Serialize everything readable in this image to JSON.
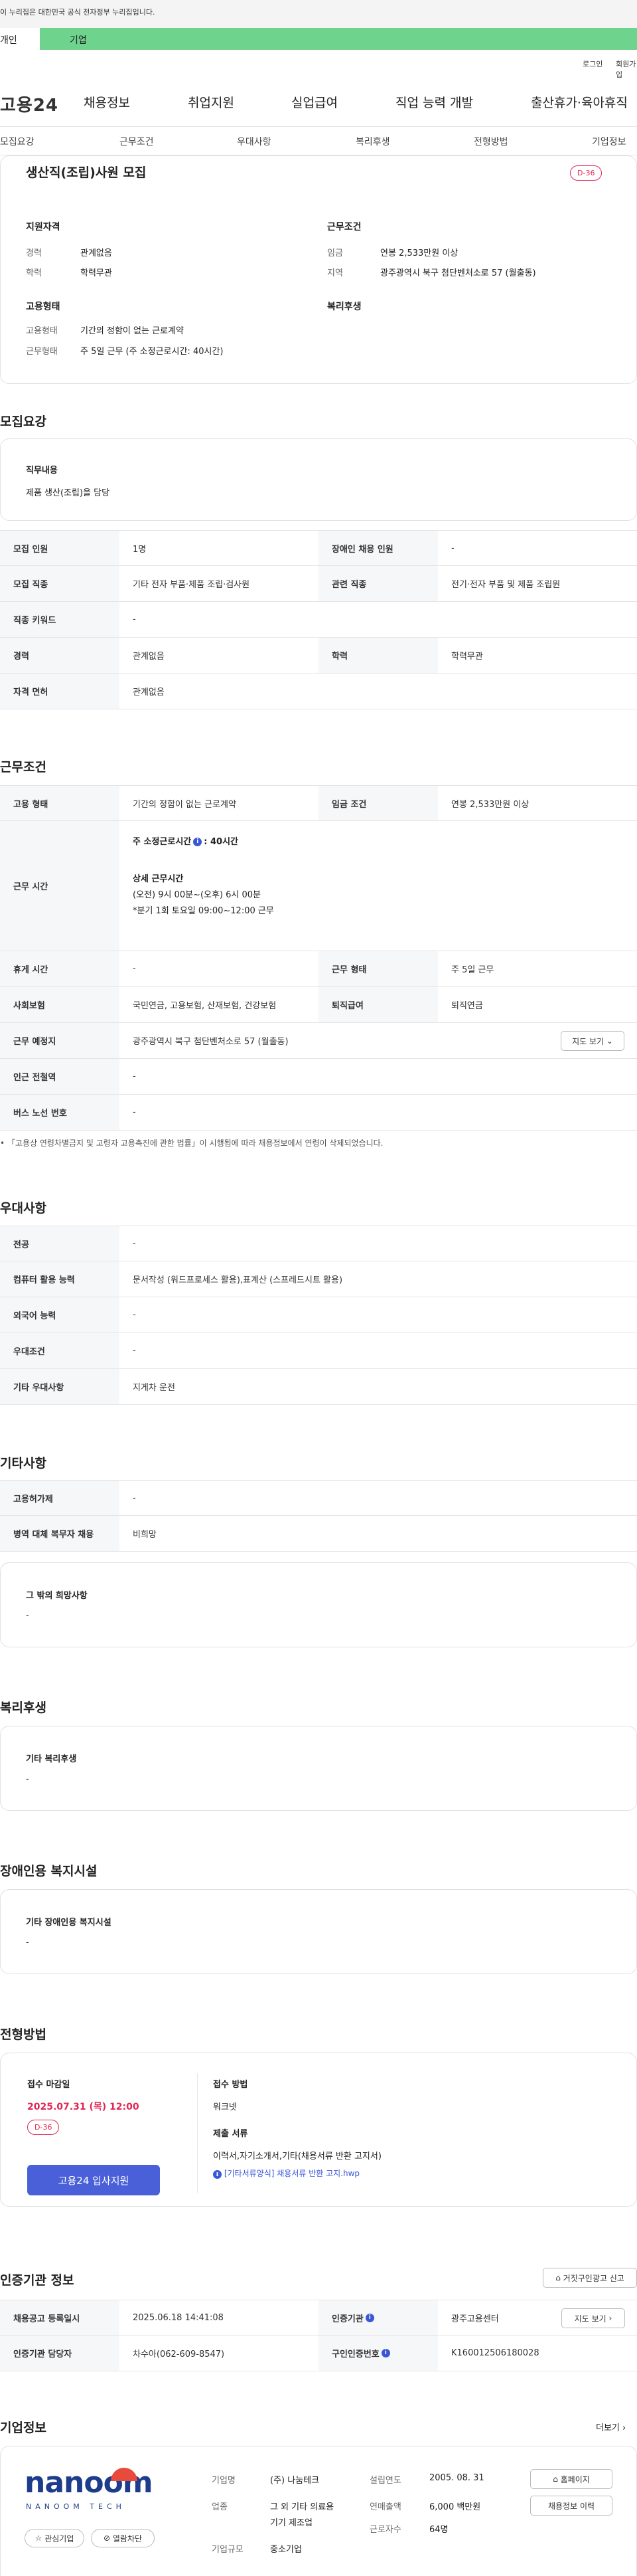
{
  "gov_banner": "이 누리집은 대한민국 공식 전자정부 누리집입니다.",
  "site_tabs": [
    "개인",
    "기업"
  ],
  "utils": [
    "로그인",
    "회원가입"
  ],
  "logo": "고용24",
  "gnb": [
    "채용정보",
    "취업지원",
    "실업급여",
    "직업 능력 개발",
    "출산휴가·육아휴직"
  ],
  "anchors": [
    "모집요강",
    "근무조건",
    "우대사항",
    "복리후생",
    "전형방법",
    "기업정보"
  ],
  "job": {
    "title": "생산직(조립)사원 모집",
    "dday": "D-36"
  },
  "summary": {
    "qual_title": "지원자격",
    "career_lbl": "경력",
    "career": "관계없음",
    "edu_lbl": "학력",
    "edu": "학력무관",
    "cond_title": "근무조건",
    "wage_lbl": "임금",
    "wage": "연봉 2,533만원 이상",
    "region_lbl": "지역",
    "region": "광주광역시 북구 첨단벤처소로 57 (월출동)",
    "emp_title": "고용형태",
    "emptype_lbl": "고용형태",
    "emptype": "기간의 정함이 없는 근로계약",
    "worktype_lbl": "근무형태",
    "worktype": "주 5일 근무 (주 소정근로시간: 40시간)",
    "welfare_title": "복리후생"
  },
  "recruit": {
    "heading": "모집요강",
    "duty_title": "직무내용",
    "duty": "제품 생산(조립)을 담당",
    "rows": [
      {
        "k1": "모집 인원",
        "v1": "1명",
        "k2": "장애인 채용 인원",
        "v2": "-"
      },
      {
        "k1": "모집 직종",
        "v1": "기타 전자 부품·제품 조립·검사원",
        "k2": "관련 직종",
        "v2": "전기·전자 부품 및 제품 조립원"
      },
      {
        "k1": "직종 키워드",
        "v1": "-"
      },
      {
        "k1": "경력",
        "v1": "관계없음",
        "k2": "학력",
        "v2": "학력무관"
      },
      {
        "k1": "자격 면허",
        "v1": "관계없음"
      }
    ]
  },
  "conditions": {
    "heading": "근무조건",
    "emp_k": "고용 형태",
    "emp_v": "기간의 정함이 없는 근로계약",
    "wage_k": "임금 조건",
    "wage_v": "연봉 2,533만원 이상",
    "hours_k": "근무 시간",
    "hours_main": "주 소정근로시간",
    "hours_val": ": 40시간",
    "detail_title": "상세 근무시간",
    "detail1": "(오전) 9시 00분~(오후) 6시 00분",
    "detail2": "*분기 1회 토요일 09:00~12:00 근무",
    "rest_k": "휴게 시간",
    "rest_v": "-",
    "form_k": "근무 형태",
    "form_v": "주 5일 근무",
    "ins_k": "사회보험",
    "ins_v": "국민연금, 고용보험, 산재보험, 건강보험",
    "ret_k": "퇴직급여",
    "ret_v": "퇴직연금",
    "place_k": "근무 예정지",
    "place_v": "광주광역시 북구 첨단벤처소로 57 (월출동)",
    "map_btn": "지도 보기",
    "station_k": "인근 전철역",
    "station_v": "-",
    "bus_k": "버스 노선 번호",
    "bus_v": "-",
    "law_note": "「고용상 연령차별금지 및 고령자 고용촉진에 관한 법률」이 시행됨에 따라 채용정보에서 연령이 삭제되었습니다."
  },
  "prefer": {
    "heading": "우대사항",
    "rows": [
      {
        "k": "전공",
        "v": "-"
      },
      {
        "k": "컴퓨터 활용 능력",
        "v": "문서작성 (워드프로세스 활용),표계산 (스프레드시트 활용)"
      },
      {
        "k": "외국어 능력",
        "v": "-"
      },
      {
        "k": "우대조건",
        "v": "-"
      },
      {
        "k": "기타 우대사항",
        "v": "지게차 운전"
      }
    ]
  },
  "etc": {
    "heading": "기타사항",
    "rows": [
      {
        "k": "고용허가제",
        "v": "-"
      },
      {
        "k": "병역 대체 복무자 채용",
        "v": "비희망"
      }
    ],
    "other_title": "그 밖의 희망사항",
    "other_v": "-"
  },
  "welfare": {
    "heading": "복리후생",
    "title": "기타 복리후생",
    "v": "-"
  },
  "disability": {
    "heading": "장애인용 복지시설",
    "title": "기타 장애인용 복지시설",
    "v": "-"
  },
  "process": {
    "heading": "전형방법",
    "deadline_lbl": "접수 마감일",
    "deadline": "2025.07.31 (목) 12:00",
    "dday": "D-36",
    "apply_btn": "고용24 입사지원",
    "method_lbl": "접수 방법",
    "method": "워크넷",
    "docs_lbl": "제출 서류",
    "docs": "이력서,자기소개서,기타(채용서류 반환 고지서)",
    "file": "[기타서류양식] 채용서류 반환 고지.hwp"
  },
  "cert": {
    "heading": "인증기관 정보",
    "report_btn": "거짓구인광고 신고",
    "reg_k": "채용공고 등록일시",
    "reg_v": "2025.06.18 14:41:08",
    "org_k": "인증기관",
    "org_v": "광주고용센터",
    "map_btn": "지도 보기",
    "staff_k": "인증기관 담당자",
    "staff_v": "차수아(062-609-8547)",
    "num_k": "구인인증번호",
    "num_v": "K160012506180028"
  },
  "company": {
    "heading": "기업정보",
    "more": "더보기",
    "logo_text": "nanoom",
    "logo_sub": "NANOOM TECH",
    "fav_btn": "관심기업",
    "block_btn": "열람차단",
    "name_k": "기업명",
    "name_v": "(주) 나눔테크",
    "ind_k": "업종",
    "ind_v1": "그 외 기타 의료용",
    "ind_v2": "기기 제조업",
    "size_k": "기업규모",
    "size_v": "중소기업",
    "est_k": "설립연도",
    "est_v": "2005. 08. 31",
    "sales_k": "연매출액",
    "sales_v": "6,000 백만원",
    "emp_k": "근로자수",
    "emp_v": "64명",
    "home_btn": "홈페이지",
    "hist_btn": "채용정보 이력"
  },
  "colors": {
    "green": "#6dd38d",
    "accent": "#e02755",
    "blue": "#4a60d9"
  }
}
